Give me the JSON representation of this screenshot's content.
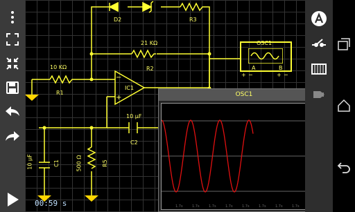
{
  "circuit": {
    "labels": {
      "r1_value": "10 KΩ",
      "r1_name": "R1",
      "r2_value": "21 KΩ",
      "r2_name": "R2",
      "r3_name": "R3",
      "d2_name": "D2",
      "ic1_name": "IC1",
      "c2_value": "10 µF",
      "c2_name": "C2",
      "c1_value": "10 µF",
      "c1_name": "C1",
      "r5_value": "500 Ω",
      "r5_name": "R5",
      "opamp_minus": "−",
      "opamp_plus": "+",
      "osc_component_name": "OSC1",
      "osc_a": "A",
      "osc_b": "B",
      "osc_a_plus": "+",
      "osc_a_minus": "−",
      "osc_b_plus": "+",
      "osc_b_minus": "−"
    }
  },
  "oscilloscope": {
    "title": "OSC1",
    "trace_color": "#e01010",
    "time_labels": [
      "1.7s",
      "1.7s",
      "1.7s",
      "1.7s",
      "1.7s",
      "1.7s",
      "1.7s",
      "1.7s",
      "1.7s",
      "1.7s"
    ]
  },
  "status": {
    "clock": "00:59 s"
  },
  "toolbar_left": {
    "icons": [
      "fullscreen-icon",
      "shrink-icon",
      "save-icon",
      "undo-icon",
      "redo-icon",
      "play-icon"
    ]
  },
  "toolbar_right": {
    "icons": [
      "add-component-icon",
      "switch-icon",
      "battery-icon",
      "plug-icon"
    ]
  },
  "colors": {
    "wire": "#ffff33",
    "ground": "#ffd700",
    "background": "#000000"
  }
}
